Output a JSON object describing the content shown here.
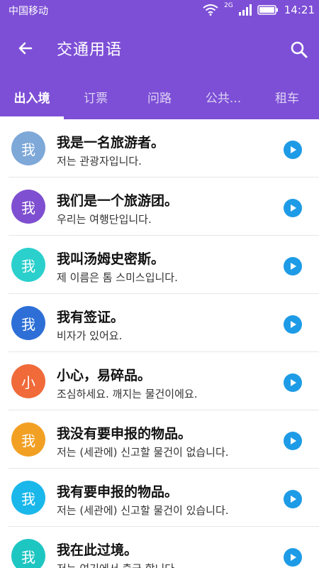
{
  "status_bar": {
    "carrier": "中国移动",
    "network": "2G",
    "time": "14:21"
  },
  "toolbar": {
    "title": "交通用语",
    "back_icon": "arrow-left-icon",
    "search_icon": "search-icon"
  },
  "tabs": [
    {
      "label": "出入境",
      "active": true
    },
    {
      "label": "订票",
      "active": false
    },
    {
      "label": "问路",
      "active": false
    },
    {
      "label": "公共...",
      "active": false
    },
    {
      "label": "租车",
      "active": false
    }
  ],
  "colors": {
    "header": "#7d4fd6",
    "play": "#1e9be6"
  },
  "phrases": [
    {
      "avatar": "我",
      "avatar_color": "#7ea8d8",
      "cn": "我是一名旅游者。",
      "kr": "저는 관광자입니다."
    },
    {
      "avatar": "我",
      "avatar_color": "#7e4fd0",
      "cn": "我们是一个旅游团。",
      "kr": "우리는 여행단입니다."
    },
    {
      "avatar": "我",
      "avatar_color": "#2bd0cc",
      "cn": "我叫汤姆史密斯。",
      "kr": "제 이름은 톰 스미스입니다."
    },
    {
      "avatar": "我",
      "avatar_color": "#2d6fd6",
      "cn": "我有签证。",
      "kr": "비자가 있어요."
    },
    {
      "avatar": "小",
      "avatar_color": "#f06a3a",
      "cn": "小心，易碎品。",
      "kr": "조심하세요. 깨지는 물건이에요."
    },
    {
      "avatar": "我",
      "avatar_color": "#f2a024",
      "cn": "我没有要申报的物品。",
      "kr": "저는 (세관에) 신고할 물건이 없습니다."
    },
    {
      "avatar": "我",
      "avatar_color": "#1ab8ea",
      "cn": "我有要申报的物品。",
      "kr": "저는 (세관에) 신고할 물건이 있습니다."
    },
    {
      "avatar": "我",
      "avatar_color": "#1ec6c2",
      "cn": "我在此过境。",
      "kr": "저는 여기에서 출국 합니다."
    }
  ]
}
